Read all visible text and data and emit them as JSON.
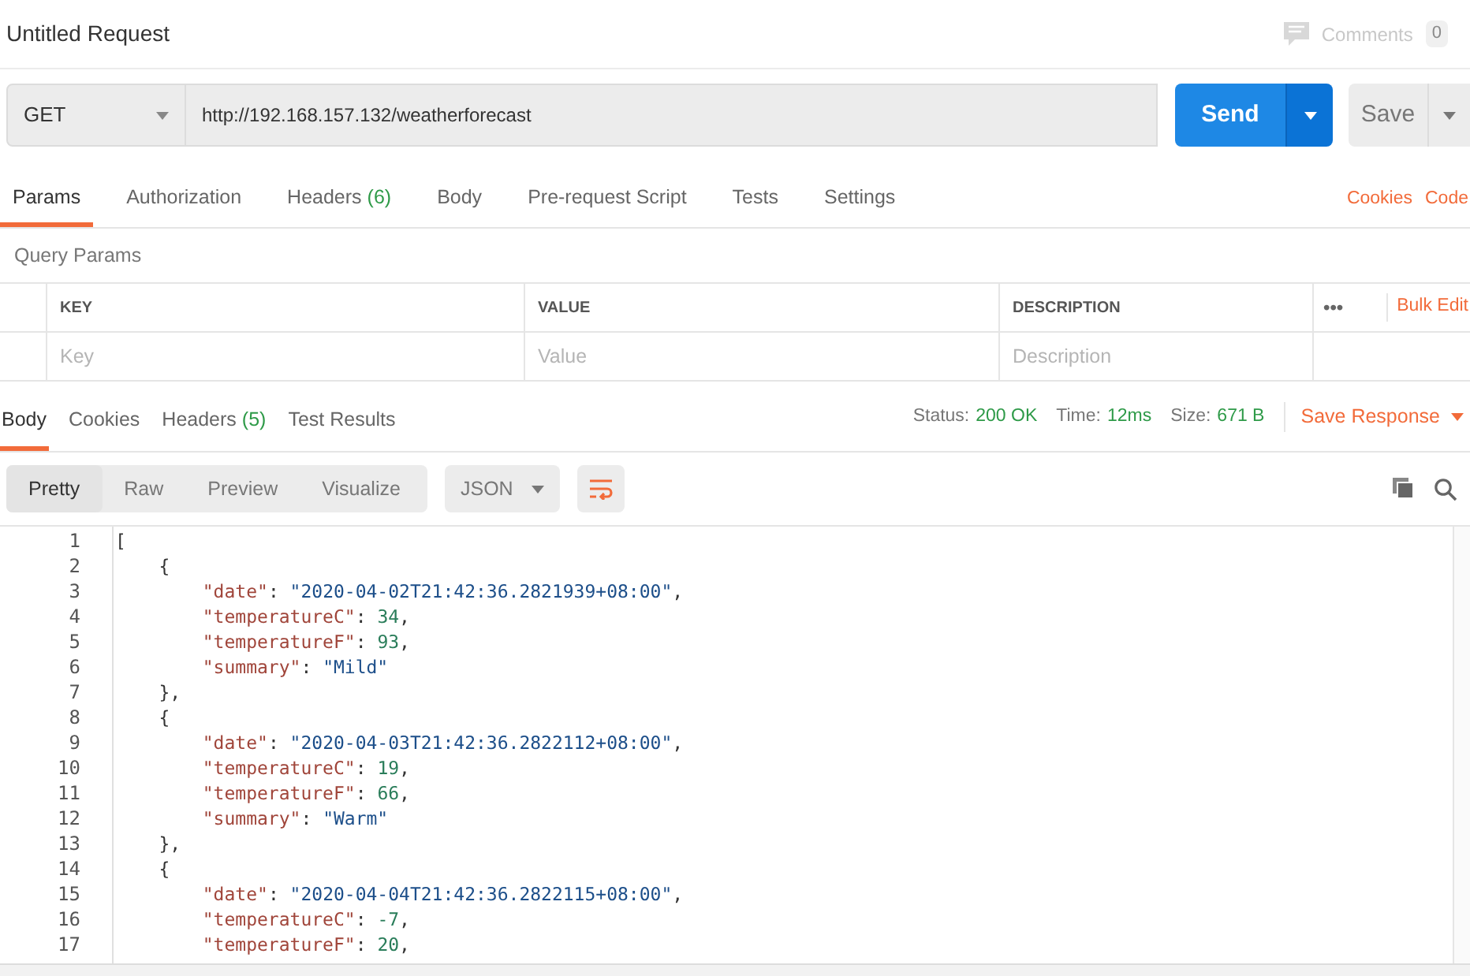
{
  "title": "Untitled Request",
  "comments": {
    "label": "Comments",
    "count": "0"
  },
  "request": {
    "method": "GET",
    "url": "http://192.168.157.132/weatherforecast",
    "send": "Send",
    "save": "Save"
  },
  "request_tabs": [
    {
      "label": "Params",
      "selected": true
    },
    {
      "label": "Authorization",
      "selected": false
    },
    {
      "label": "Headers",
      "count": "(6)",
      "selected": false
    },
    {
      "label": "Body",
      "selected": false
    },
    {
      "label": "Pre-request Script",
      "selected": false
    },
    {
      "label": "Tests",
      "selected": false
    },
    {
      "label": "Settings",
      "selected": false
    }
  ],
  "request_links": [
    "Cookies",
    "Code"
  ],
  "query_params": {
    "title": "Query Params",
    "columns": [
      "KEY",
      "VALUE",
      "DESCRIPTION"
    ],
    "more": "•••",
    "bulk_edit": "Bulk Edit",
    "placeholders": [
      "Key",
      "Value",
      "Description"
    ]
  },
  "response_tabs": [
    {
      "label": "Body",
      "selected": true
    },
    {
      "label": "Cookies",
      "selected": false
    },
    {
      "label": "Headers",
      "count": "(5)",
      "selected": false
    },
    {
      "label": "Test Results",
      "selected": false
    }
  ],
  "response_meta": [
    {
      "label": "Status:",
      "value": "200 OK"
    },
    {
      "label": "Time:",
      "value": "12ms"
    },
    {
      "label": "Size:",
      "value": "671 B"
    }
  ],
  "save_response": "Save Response",
  "view_modes": [
    {
      "label": "Pretty",
      "selected": true
    },
    {
      "label": "Raw",
      "selected": false
    },
    {
      "label": "Preview",
      "selected": false
    },
    {
      "label": "Visualize",
      "selected": false
    }
  ],
  "format": "JSON",
  "code_lines": [
    {
      "number": "1",
      "tokens": [
        {
          "kind": "punct",
          "text": "["
        }
      ]
    },
    {
      "number": "2",
      "tokens": [
        {
          "kind": "punct",
          "text": "    {"
        }
      ]
    },
    {
      "number": "3",
      "tokens": [
        {
          "kind": "key",
          "text": "        \"date\""
        },
        {
          "kind": "punct",
          "text": ": "
        },
        {
          "kind": "string",
          "text": "\"2020-04-02T21:42:36.2821939+08:00\""
        },
        {
          "kind": "punct",
          "text": ","
        }
      ]
    },
    {
      "number": "4",
      "tokens": [
        {
          "kind": "key",
          "text": "        \"temperatureC\""
        },
        {
          "kind": "punct",
          "text": ": "
        },
        {
          "kind": "number",
          "text": "34"
        },
        {
          "kind": "punct",
          "text": ","
        }
      ]
    },
    {
      "number": "5",
      "tokens": [
        {
          "kind": "key",
          "text": "        \"temperatureF\""
        },
        {
          "kind": "punct",
          "text": ": "
        },
        {
          "kind": "number",
          "text": "93"
        },
        {
          "kind": "punct",
          "text": ","
        }
      ]
    },
    {
      "number": "6",
      "tokens": [
        {
          "kind": "key",
          "text": "        \"summary\""
        },
        {
          "kind": "punct",
          "text": ": "
        },
        {
          "kind": "string",
          "text": "\"Mild\""
        }
      ]
    },
    {
      "number": "7",
      "tokens": [
        {
          "kind": "punct",
          "text": "    },"
        }
      ]
    },
    {
      "number": "8",
      "tokens": [
        {
          "kind": "punct",
          "text": "    {"
        }
      ]
    },
    {
      "number": "9",
      "tokens": [
        {
          "kind": "key",
          "text": "        \"date\""
        },
        {
          "kind": "punct",
          "text": ": "
        },
        {
          "kind": "string",
          "text": "\"2020-04-03T21:42:36.2822112+08:00\""
        },
        {
          "kind": "punct",
          "text": ","
        }
      ]
    },
    {
      "number": "10",
      "tokens": [
        {
          "kind": "key",
          "text": "        \"temperatureC\""
        },
        {
          "kind": "punct",
          "text": ": "
        },
        {
          "kind": "number",
          "text": "19"
        },
        {
          "kind": "punct",
          "text": ","
        }
      ]
    },
    {
      "number": "11",
      "tokens": [
        {
          "kind": "key",
          "text": "        \"temperatureF\""
        },
        {
          "kind": "punct",
          "text": ": "
        },
        {
          "kind": "number",
          "text": "66"
        },
        {
          "kind": "punct",
          "text": ","
        }
      ]
    },
    {
      "number": "12",
      "tokens": [
        {
          "kind": "key",
          "text": "        \"summary\""
        },
        {
          "kind": "punct",
          "text": ": "
        },
        {
          "kind": "string",
          "text": "\"Warm\""
        }
      ]
    },
    {
      "number": "13",
      "tokens": [
        {
          "kind": "punct",
          "text": "    },"
        }
      ]
    },
    {
      "number": "14",
      "tokens": [
        {
          "kind": "punct",
          "text": "    {"
        }
      ]
    },
    {
      "number": "15",
      "tokens": [
        {
          "kind": "key",
          "text": "        \"date\""
        },
        {
          "kind": "punct",
          "text": ": "
        },
        {
          "kind": "string",
          "text": "\"2020-04-04T21:42:36.2822115+08:00\""
        },
        {
          "kind": "punct",
          "text": ","
        }
      ]
    },
    {
      "number": "16",
      "tokens": [
        {
          "kind": "key",
          "text": "        \"temperatureC\""
        },
        {
          "kind": "punct",
          "text": ": "
        },
        {
          "kind": "number",
          "text": "-7"
        },
        {
          "kind": "punct",
          "text": ","
        }
      ]
    },
    {
      "number": "17",
      "tokens": [
        {
          "kind": "key",
          "text": "        \"temperatureF\""
        },
        {
          "kind": "punct",
          "text": ": "
        },
        {
          "kind": "number",
          "text": "20"
        },
        {
          "kind": "punct",
          "text": ","
        }
      ]
    }
  ]
}
